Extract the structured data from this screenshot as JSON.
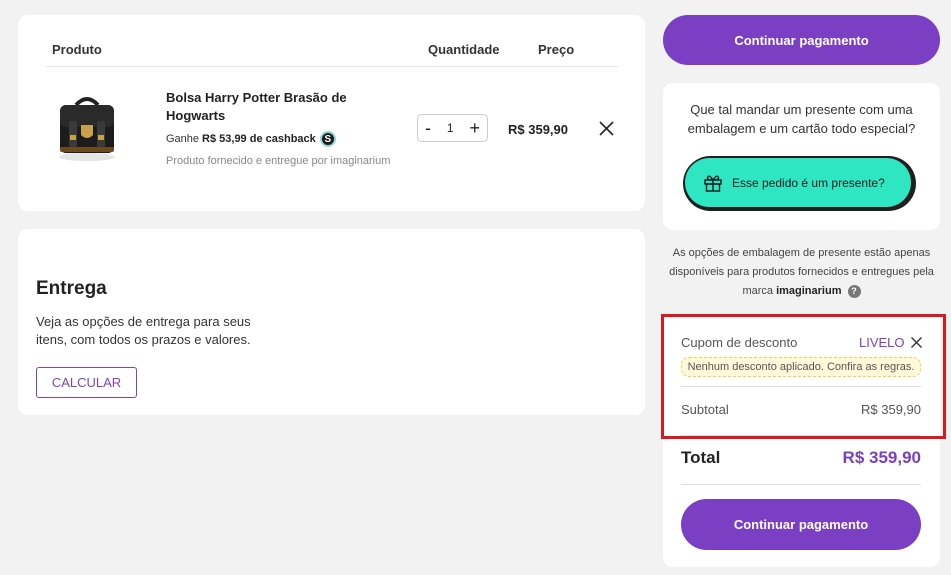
{
  "product_table": {
    "headers": {
      "product": "Produto",
      "quantity": "Quantidade",
      "price": "Preço"
    },
    "item": {
      "name": "Bolsa Harry Potter Brasão de Hogwarts",
      "cashback_prefix": "Ganhe",
      "cashback_value": "R$ 53,99 de cashback",
      "cashback_icon_glyph": "S",
      "supplied_by": "Produto fornecido e entregue por imaginarium",
      "qty_minus": "-",
      "quantity": "1",
      "qty_plus": "+",
      "price": "R$ 359,90"
    }
  },
  "delivery": {
    "title": "Entrega",
    "description": "Veja as opções de entrega para seus itens, com todos os prazos e valores.",
    "calculate_label": "CALCULAR"
  },
  "checkout": {
    "continue_label": "Continuar pagamento"
  },
  "gift": {
    "question": "Que tal mandar um presente com uma embalagem e um cartão todo especial?",
    "button_label": "Esse pedido é um presente?",
    "note_prefix": "As opções de embalagem de presente estão apenas disponíveis para produtos fornecidos e entregues pela marca",
    "note_brand": "imaginarium",
    "help_glyph": "?"
  },
  "summary": {
    "coupon_label": "Cupom de desconto",
    "coupon_code": "LIVELO",
    "coupon_message": "Nenhum desconto aplicado. Confira as regras.",
    "subtotal_label": "Subtotal",
    "subtotal_value": "R$ 359,90",
    "total_label": "Total",
    "total_value": "R$ 359,90"
  },
  "colors": {
    "brand_purple": "#7b3fc4",
    "gift_teal": "#2ee6c2",
    "highlight_red": "#d9191f",
    "coupon_warning_bg": "#fff9d9"
  },
  "icons": {
    "remove_item": "close-icon",
    "gift": "gift-icon",
    "help": "help-icon",
    "coupon_remove": "close-icon",
    "cashback": "cashback-coin-icon"
  }
}
